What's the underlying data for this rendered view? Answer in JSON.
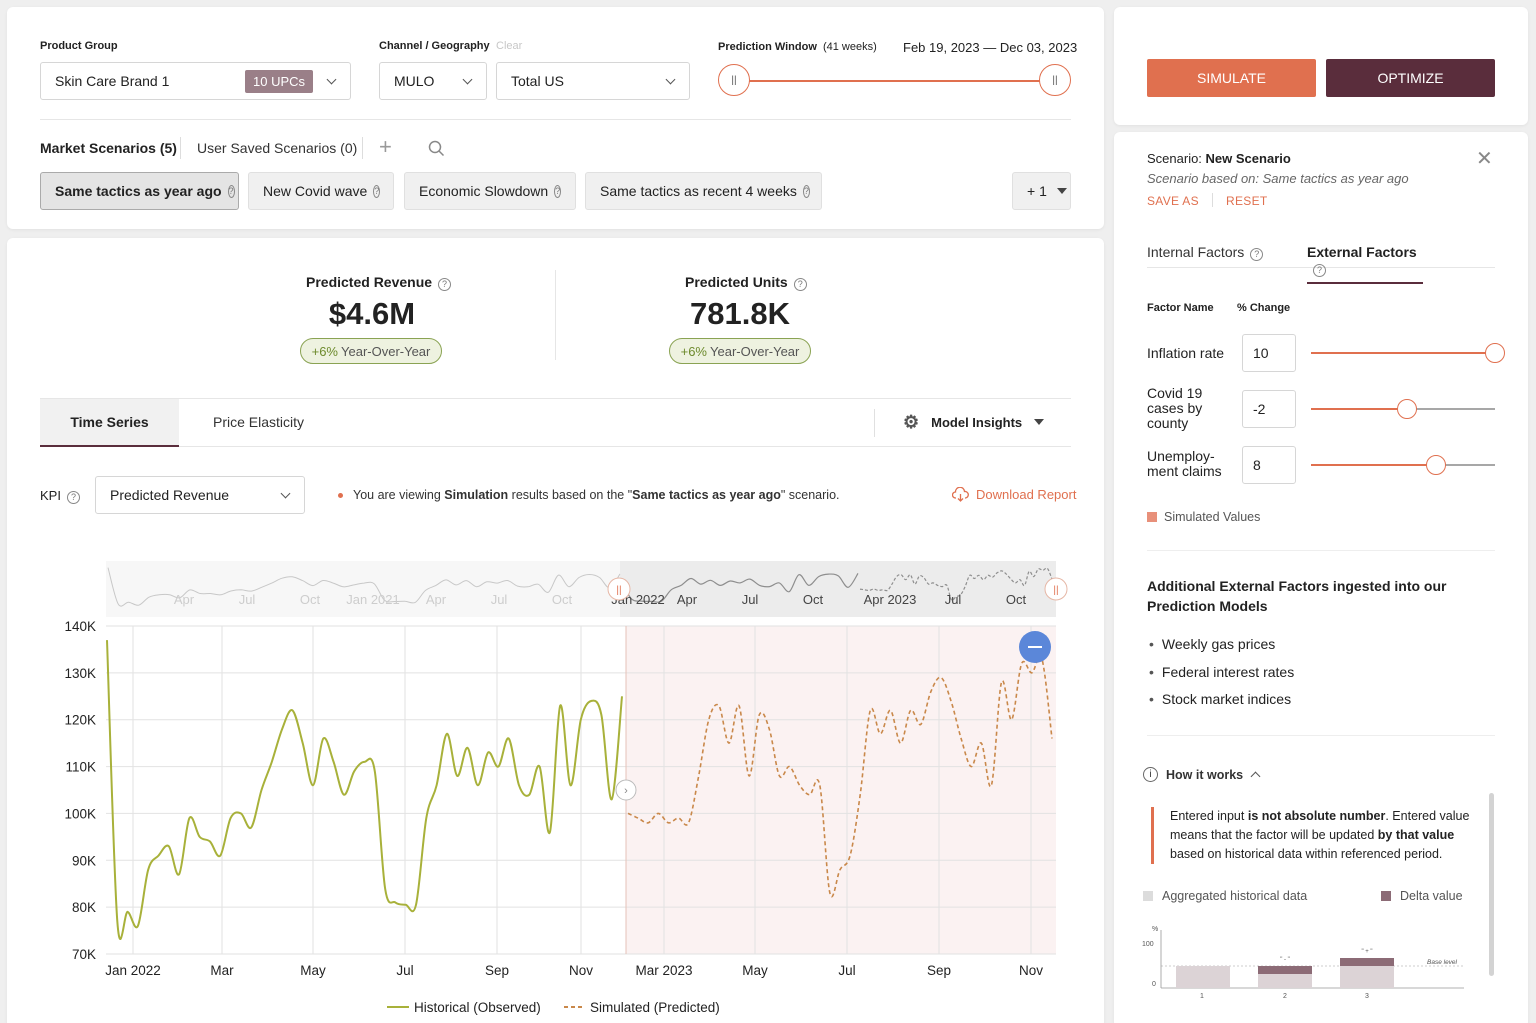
{
  "filters": {
    "product_group_label": "Product Group",
    "product_group_value": "Skin Care Brand 1",
    "upc_badge": "10 UPCs",
    "channel_label": "Channel / Geography",
    "clear_label": "Clear",
    "channel_value": "MULO",
    "geo_value": "Total US",
    "prediction_window_label": "Prediction Window",
    "prediction_window_weeks": "(41 weeks)",
    "prediction_window_range": "Feb 19, 2023 — Dec 03, 2023"
  },
  "scenarios": {
    "market_tab": "Market Scenarios (5)",
    "user_tab": "User Saved Scenarios (0)",
    "items": [
      "Same tactics as year ago",
      "New Covid wave",
      "Economic Slowdown",
      "Same tactics as recent 4 weeks"
    ],
    "more": "+ 1"
  },
  "actions": {
    "simulate": "SIMULATE",
    "optimize": "OPTIMIZE"
  },
  "kpis": {
    "revenue_label": "Predicted Revenue",
    "revenue_value": "$4.6M",
    "revenue_yoy_pct": "+6%",
    "revenue_yoy_text": "Year-Over-Year",
    "units_label": "Predicted Units",
    "units_value": "781.8K",
    "units_yoy_pct": "+6%",
    "units_yoy_text": "Year-Over-Year"
  },
  "tabs": {
    "time_series": "Time Series",
    "price_elasticity": "Price Elasticity",
    "model_insights": "Model Insights"
  },
  "kpi_select": {
    "label": "KPI",
    "value": "Predicted Revenue",
    "info_pre": "You are viewing ",
    "info_bold1": "Simulation",
    "info_mid": " results based on the \"",
    "info_bold2": "Same tactics as year ago",
    "info_post": "\" scenario.",
    "download": "Download Report"
  },
  "chart_data": {
    "type": "line",
    "ylim": [
      70000,
      140000
    ],
    "y_ticks": [
      "140K",
      "130K",
      "120K",
      "110K",
      "100K",
      "90K",
      "80K",
      "70K"
    ],
    "x_ticks": [
      "Jan 2022",
      "Mar",
      "May",
      "Jul",
      "Sep",
      "Nov",
      "Mar 2023",
      "May",
      "Jul",
      "Sep",
      "Nov"
    ],
    "navigator_ticks": [
      "Apr",
      "Jul",
      "Oct",
      "Jan 2021",
      "Apr",
      "Jul",
      "Oct",
      "Jan 2022",
      "Apr",
      "Jul",
      "Oct",
      "Apr 2023",
      "Jul",
      "Oct"
    ],
    "legend": [
      "Historical (Observed)",
      "Simulated (Predicted)"
    ],
    "colors": {
      "historical": "#a8b13a",
      "simulated": "#c9884a",
      "sim_region": "#fbf2f2",
      "zoom_button": "#5b87d9"
    },
    "series": [
      {
        "name": "Historical (Observed)",
        "values": [
          137000,
          77000,
          79000,
          76000,
          88000,
          91000,
          93000,
          87000,
          99000,
          95000,
          94000,
          91000,
          99000,
          100000,
          97000,
          105000,
          111000,
          118000,
          122000,
          115000,
          106000,
          116000,
          111000,
          104000,
          109000,
          111000,
          109000,
          84000,
          81000,
          80500,
          80500,
          99000,
          106000,
          117000,
          108000,
          114000,
          106000,
          113000,
          110000,
          116000,
          106000,
          104000,
          110000,
          96000,
          123000,
          106000,
          120000,
          124000,
          121000,
          103000,
          125000
        ]
      },
      {
        "name": "Simulated (Predicted)",
        "values": [
          100000,
          99000,
          98000,
          100000,
          98000,
          99000,
          98000,
          108000,
          120000,
          123000,
          115000,
          123000,
          108000,
          121000,
          118000,
          108000,
          110000,
          106000,
          104000,
          106000,
          83000,
          88000,
          91000,
          104000,
          122000,
          117000,
          122000,
          115000,
          122000,
          119000,
          126000,
          129000,
          124000,
          116000,
          110000,
          115000,
          106000,
          128000,
          120000,
          132000,
          130000,
          133000,
          116000
        ]
      }
    ]
  },
  "right_panel": {
    "scenario_prefix": "Scenario: ",
    "scenario_name": "New Scenario",
    "scenario_based": "Scenario based on: Same tactics as year ago",
    "save_as": "SAVE AS",
    "reset": "RESET",
    "tab_internal": "Internal Factors",
    "tab_external": "External Factors",
    "col_factor": "Factor Name",
    "col_change": "% Change",
    "factors": [
      {
        "name": "Inflation rate",
        "value": "10",
        "level": 1.0
      },
      {
        "name": "Covid 19 cases by county",
        "value": "-2",
        "level": 0.52
      },
      {
        "name": "Unemploy-ment claims",
        "value": "8",
        "level": 0.68
      }
    ],
    "simulated_values": "Simulated Values",
    "additional_title": "Additional External Factors ingested into our Prediction Models",
    "additional_items": [
      "Weekly gas prices",
      "Federal interest rates",
      "Stock market indices"
    ],
    "how_it_works": "How it works",
    "note_1": "Entered input ",
    "note_bold1": "is not absolute number",
    "note_2": ". Entered value means that the factor will be updated ",
    "note_bold2": "by that value",
    "note_3": " based on historical data within referenced period.",
    "legend_agg": "Aggregated historical data",
    "legend_delta": "Delta value",
    "mini_chart": {
      "y_label": "%",
      "y_ticks": [
        "100",
        "0"
      ],
      "categories": [
        "1",
        "2",
        "3"
      ],
      "bar_labels": [
        "",
        "\" - \"",
        "\" + \""
      ],
      "base_label": "Base level"
    }
  }
}
